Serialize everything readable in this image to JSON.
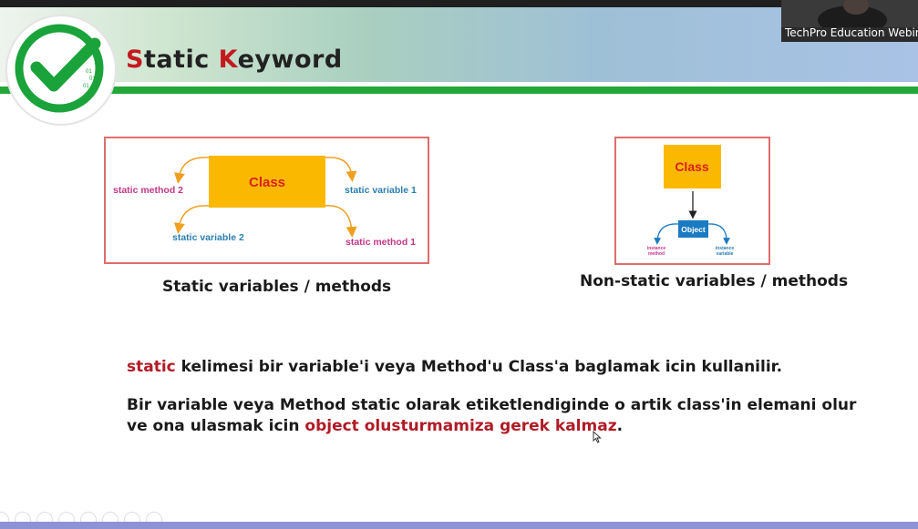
{
  "slide": {
    "title_letter1": "S",
    "title_rest1": "tatic ",
    "title_letter2": "K",
    "title_rest2": "eyword",
    "logo_binary": [
      "01",
      "01",
      "01"
    ]
  },
  "webcam": {
    "label": "TechPro Education Webin"
  },
  "static_diagram": {
    "class_label": "Class",
    "labels": [
      "static method 2",
      "static variable 1",
      "static variable 2",
      "static method 1"
    ],
    "caption": "Static variables / methods"
  },
  "nonstatic_diagram": {
    "class_label": "Class",
    "object_label": "Object",
    "left_label": [
      "instance",
      "method"
    ],
    "right_label": [
      "instance",
      "variable"
    ],
    "caption": "Non-static variables / methods"
  },
  "text": {
    "line1_highlight": "static",
    "line1_rest": " kelimesi bir variable'i veya Method'u Class'a baglamak icin kullanilir.",
    "line2": "Bir variable veya Method static olarak etiketlendiginde o artik class'in elemani olur",
    "line3_start": "ve ona ulasmak icin ",
    "line3_highlight": "object olusturmamiza gerek kalmaz",
    "line3_end": "."
  },
  "colors": {
    "accent_red": "#b01b26",
    "brand_green": "#22a838",
    "class_box": "#fbb800",
    "object_box": "#1a7bc2",
    "label_pink": "#c23789",
    "label_blue": "#2a7fb0"
  }
}
